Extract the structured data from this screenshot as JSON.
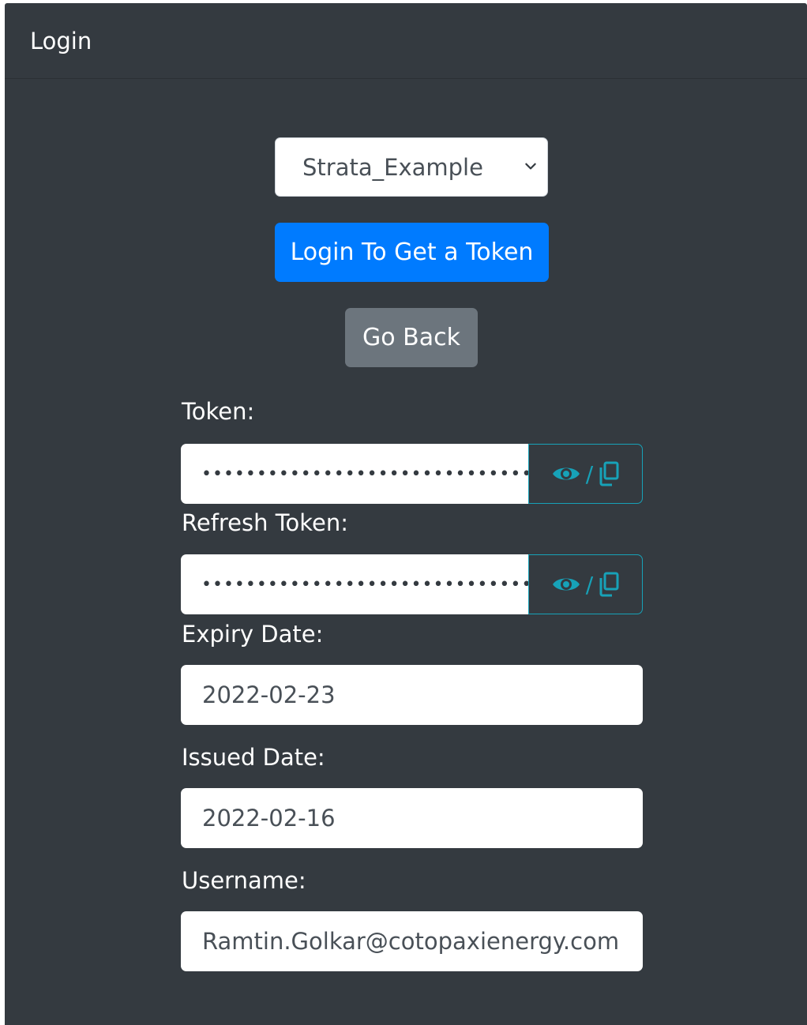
{
  "header": {
    "title": "Login"
  },
  "tenant_select": {
    "selected": "Strata_Example"
  },
  "buttons": {
    "login": "Login To Get a Token",
    "go_back": "Go Back"
  },
  "token": {
    "label": "Token:",
    "masked_value": "•••••••••••••••••••••••••••••••",
    "reveal_copy_separator": "/"
  },
  "refresh_token": {
    "label": "Refresh Token:",
    "masked_value": "•••••••••••••••••••••••••••••••",
    "reveal_copy_separator": "/"
  },
  "expiry_date": {
    "label": "Expiry Date:",
    "value": "2022-02-23"
  },
  "issued_date": {
    "label": "Issued Date:",
    "value": "2022-02-16"
  },
  "username": {
    "label": "Username:",
    "value": "Ramtin.Golkar@cotopaxienergy.com"
  },
  "colors": {
    "panel_bg": "#343a40",
    "primary": "#007bff",
    "secondary": "#6c757d",
    "info_outline": "#17a2b8"
  },
  "icons": {
    "reveal": "eye-icon",
    "copy": "copy-icon",
    "dropdown": "chevron-down-icon"
  }
}
